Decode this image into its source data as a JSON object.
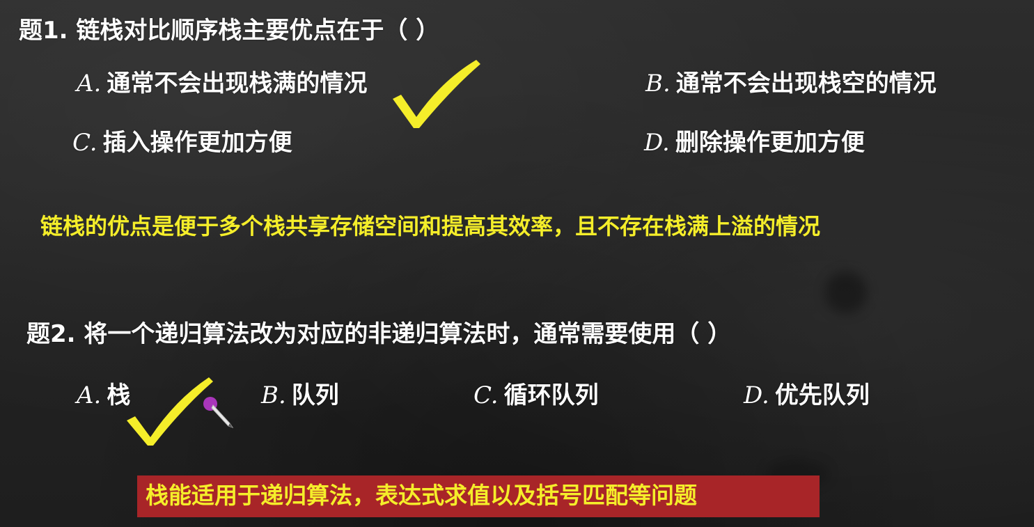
{
  "question1": {
    "stem": "题1. 链栈对比顺序栈主要优点在于（      ）",
    "options": [
      {
        "letter": "A.",
        "text": "通常不会出现栈满的情况"
      },
      {
        "letter": "B.",
        "text": "通常不会出现栈空的情况"
      },
      {
        "letter": "C.",
        "text": "插入操作更加方便"
      },
      {
        "letter": "D.",
        "text": "删除操作更加方便"
      }
    ],
    "answer_marked": "A",
    "explanation": "链栈的优点是便于多个栈共享存储空间和提高其效率，且不存在栈满上溢的情况"
  },
  "question2": {
    "stem": "题2. 将一个递归算法改为对应的非递归算法时，通常需要使用（      ）",
    "options": [
      {
        "letter": "A.",
        "text": "栈"
      },
      {
        "letter": "B.",
        "text": "队列"
      },
      {
        "letter": "C.",
        "text": "循环队列"
      },
      {
        "letter": "D.",
        "text": "优先队列"
      }
    ],
    "answer_marked": "A",
    "explanation": "栈能适用于递归算法，表达式求值以及括号匹配等问题"
  },
  "colors": {
    "background": "#262626",
    "text": "#ffffff",
    "highlight": "#f5ee2a",
    "banner": "#a82528",
    "check": "#f5ee2a"
  },
  "icons": {
    "check_mark": "check-icon",
    "pen_cursor": "pen-cursor-icon"
  }
}
